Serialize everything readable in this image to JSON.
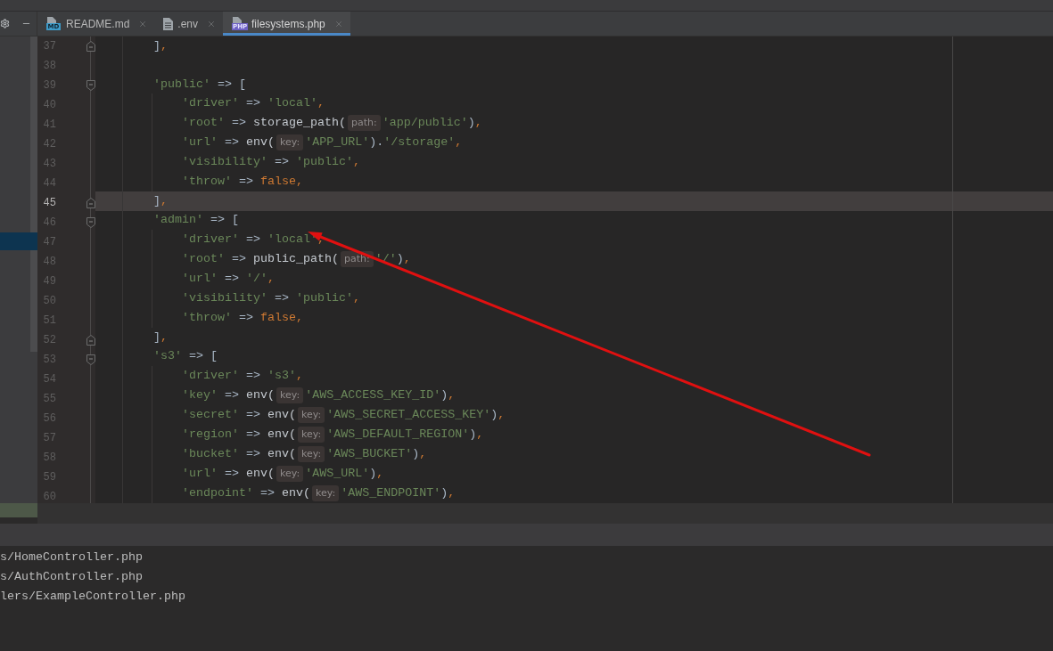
{
  "tabs": [
    {
      "label": "README.md",
      "kind": "md",
      "badge": "MD",
      "selected": false
    },
    {
      "label": ".env",
      "kind": "text",
      "selected": false
    },
    {
      "label": "filesystems.php",
      "kind": "php",
      "badge": "PHP",
      "selected": true
    }
  ],
  "editor": {
    "lines": [
      {
        "number": "37",
        "kind": "close",
        "current": false,
        "tokens": [
          {
            "kind": "punct",
            "text": "]"
          },
          {
            "kind": "comma",
            "text": ","
          }
        ]
      },
      {
        "number": "38",
        "current": false
      },
      {
        "number": "39",
        "kind": "open",
        "current": false,
        "tokens": [
          {
            "kind": "string",
            "text": "'public'"
          },
          {
            "kind": "operator",
            "text": " => "
          },
          {
            "kind": "punct",
            "text": "["
          }
        ],
        "children": [
          {
            "number": "40",
            "current": false,
            "tokens": [
              {
                "kind": "string",
                "text": "'driver'"
              },
              {
                "kind": "operator",
                "text": " => "
              },
              {
                "kind": "string",
                "text": "'local'"
              },
              {
                "kind": "comma",
                "text": ","
              }
            ]
          },
          {
            "number": "41",
            "current": false,
            "tokens": [
              {
                "kind": "string",
                "text": "'root'"
              },
              {
                "kind": "operator",
                "text": " => "
              },
              {
                "kind": "function",
                "text": "storage_path("
              },
              {
                "kind": "hint",
                "text": "path:"
              },
              {
                "kind": "string",
                "text": "'app/public'"
              },
              {
                "kind": "punct",
                "text": ")"
              },
              {
                "kind": "comma",
                "text": ","
              }
            ]
          },
          {
            "number": "42",
            "current": false,
            "tokens": [
              {
                "kind": "string",
                "text": "'url'"
              },
              {
                "kind": "operator",
                "text": " => "
              },
              {
                "kind": "function",
                "text": "env("
              },
              {
                "kind": "hint",
                "text": "key:"
              },
              {
                "kind": "string",
                "text": "'APP_URL'"
              },
              {
                "kind": "punct",
                "text": ")."
              },
              {
                "kind": "string",
                "text": "'/storage'"
              },
              {
                "kind": "comma",
                "text": ","
              }
            ]
          },
          {
            "number": "43",
            "current": false,
            "tokens": [
              {
                "kind": "string",
                "text": "'visibility'"
              },
              {
                "kind": "operator",
                "text": " => "
              },
              {
                "kind": "string",
                "text": "'public'"
              },
              {
                "kind": "comma",
                "text": ","
              }
            ]
          },
          {
            "number": "44",
            "current": false,
            "tokens": [
              {
                "kind": "string",
                "text": "'throw'"
              },
              {
                "kind": "operator",
                "text": " => "
              },
              {
                "kind": "keyword",
                "text": "false"
              },
              {
                "kind": "comma",
                "text": ","
              }
            ]
          }
        ]
      },
      {
        "number": "45",
        "kind": "close",
        "current": true,
        "tokens": [
          {
            "kind": "punct",
            "text": "]"
          },
          {
            "kind": "comma",
            "text": ","
          }
        ]
      },
      {
        "number": "46",
        "kind": "open",
        "current": false,
        "tokens": [
          {
            "kind": "string",
            "text": "'admin'"
          },
          {
            "kind": "operator",
            "text": " => "
          },
          {
            "kind": "punct",
            "text": "["
          }
        ],
        "children": [
          {
            "number": "47",
            "current": false,
            "tokens": [
              {
                "kind": "string",
                "text": "'driver'"
              },
              {
                "kind": "operator",
                "text": " => "
              },
              {
                "kind": "string",
                "text": "'local'"
              },
              {
                "kind": "comma",
                "text": ","
              }
            ]
          },
          {
            "number": "48",
            "current": false,
            "tokens": [
              {
                "kind": "string",
                "text": "'root'"
              },
              {
                "kind": "operator",
                "text": " => "
              },
              {
                "kind": "function",
                "text": "public_path("
              },
              {
                "kind": "hint",
                "text": "path:"
              },
              {
                "kind": "string",
                "text": "'/'"
              },
              {
                "kind": "punct",
                "text": ")"
              },
              {
                "kind": "comma",
                "text": ","
              }
            ]
          },
          {
            "number": "49",
            "current": false,
            "tokens": [
              {
                "kind": "string",
                "text": "'url'"
              },
              {
                "kind": "operator",
                "text": " => "
              },
              {
                "kind": "string",
                "text": "'/'"
              },
              {
                "kind": "comma",
                "text": ","
              }
            ]
          },
          {
            "number": "50",
            "current": false,
            "tokens": [
              {
                "kind": "string",
                "text": "'visibility'"
              },
              {
                "kind": "operator",
                "text": " => "
              },
              {
                "kind": "string",
                "text": "'public'"
              },
              {
                "kind": "comma",
                "text": ","
              }
            ]
          },
          {
            "number": "51",
            "current": false,
            "tokens": [
              {
                "kind": "string",
                "text": "'throw'"
              },
              {
                "kind": "operator",
                "text": " => "
              },
              {
                "kind": "keyword",
                "text": "false"
              },
              {
                "kind": "comma",
                "text": ","
              }
            ]
          }
        ]
      },
      {
        "number": "52",
        "kind": "close",
        "current": false,
        "tokens": [
          {
            "kind": "punct",
            "text": "]"
          },
          {
            "kind": "comma",
            "text": ","
          }
        ]
      },
      {
        "number": "53",
        "kind": "open",
        "current": false,
        "tokens": [
          {
            "kind": "string",
            "text": "'s3'"
          },
          {
            "kind": "operator",
            "text": " => "
          },
          {
            "kind": "punct",
            "text": "["
          }
        ],
        "children": [
          {
            "number": "54",
            "current": false,
            "tokens": [
              {
                "kind": "string",
                "text": "'driver'"
              },
              {
                "kind": "operator",
                "text": " => "
              },
              {
                "kind": "string",
                "text": "'s3'"
              },
              {
                "kind": "comma",
                "text": ","
              }
            ]
          },
          {
            "number": "55",
            "current": false,
            "tokens": [
              {
                "kind": "string",
                "text": "'key'"
              },
              {
                "kind": "operator",
                "text": " => "
              },
              {
                "kind": "function",
                "text": "env("
              },
              {
                "kind": "hint",
                "text": "key:"
              },
              {
                "kind": "string",
                "text": "'AWS_ACCESS_KEY_ID'"
              },
              {
                "kind": "punct",
                "text": ")"
              },
              {
                "kind": "comma",
                "text": ","
              }
            ]
          },
          {
            "number": "56",
            "current": false,
            "tokens": [
              {
                "kind": "string",
                "text": "'secret'"
              },
              {
                "kind": "operator",
                "text": " => "
              },
              {
                "kind": "function",
                "text": "env("
              },
              {
                "kind": "hint",
                "text": "key:"
              },
              {
                "kind": "string",
                "text": "'AWS_SECRET_ACCESS_KEY'"
              },
              {
                "kind": "punct",
                "text": ")"
              },
              {
                "kind": "comma",
                "text": ","
              }
            ]
          },
          {
            "number": "57",
            "current": false,
            "tokens": [
              {
                "kind": "string",
                "text": "'region'"
              },
              {
                "kind": "operator",
                "text": " => "
              },
              {
                "kind": "function",
                "text": "env("
              },
              {
                "kind": "hint",
                "text": "key:"
              },
              {
                "kind": "string",
                "text": "'AWS_DEFAULT_REGION'"
              },
              {
                "kind": "punct",
                "text": ")"
              },
              {
                "kind": "comma",
                "text": ","
              }
            ]
          },
          {
            "number": "58",
            "current": false,
            "tokens": [
              {
                "kind": "string",
                "text": "'bucket'"
              },
              {
                "kind": "operator",
                "text": " => "
              },
              {
                "kind": "function",
                "text": "env("
              },
              {
                "kind": "hint",
                "text": "key:"
              },
              {
                "kind": "string",
                "text": "'AWS_BUCKET'"
              },
              {
                "kind": "punct",
                "text": ")"
              },
              {
                "kind": "comma",
                "text": ","
              }
            ]
          },
          {
            "number": "59",
            "current": false,
            "tokens": [
              {
                "kind": "string",
                "text": "'url'"
              },
              {
                "kind": "operator",
                "text": " => "
              },
              {
                "kind": "function",
                "text": "env("
              },
              {
                "kind": "hint",
                "text": "key:"
              },
              {
                "kind": "string",
                "text": "'AWS_URL'"
              },
              {
                "kind": "punct",
                "text": ")"
              },
              {
                "kind": "comma",
                "text": ","
              }
            ]
          },
          {
            "number": "60",
            "current": false,
            "tokens": [
              {
                "kind": "string",
                "text": "'endpoint'"
              },
              {
                "kind": "operator",
                "text": " => "
              },
              {
                "kind": "function",
                "text": "env("
              },
              {
                "kind": "hint",
                "text": "key:"
              },
              {
                "kind": "string",
                "text": "'AWS_ENDPOINT'"
              },
              {
                "kind": "punct",
                "text": ")"
              },
              {
                "kind": "comma",
                "text": ","
              }
            ]
          }
        ]
      }
    ]
  },
  "bottom_panel": {
    "items": [
      "s/HomeController.php",
      "s/AuthController.php",
      "lers/ExampleController.php"
    ]
  }
}
